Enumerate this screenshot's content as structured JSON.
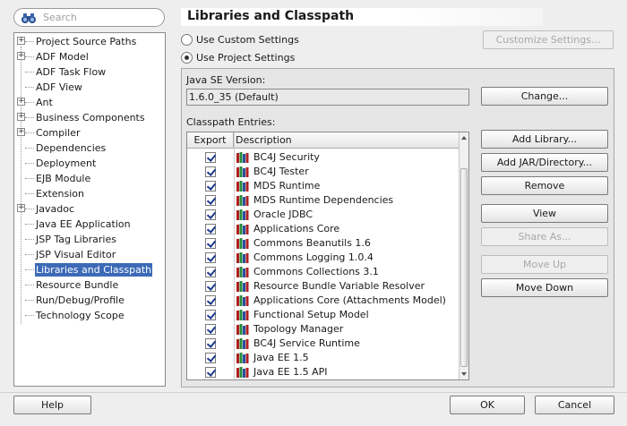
{
  "search": {
    "placeholder": "Search"
  },
  "nav": {
    "items": [
      {
        "label": "Project Source Paths",
        "expandable": true
      },
      {
        "label": "ADF Model",
        "expandable": true
      },
      {
        "label": "ADF Task Flow",
        "expandable": false
      },
      {
        "label": "ADF View",
        "expandable": false
      },
      {
        "label": "Ant",
        "expandable": true
      },
      {
        "label": "Business Components",
        "expandable": true
      },
      {
        "label": "Compiler",
        "expandable": true
      },
      {
        "label": "Dependencies",
        "expandable": false
      },
      {
        "label": "Deployment",
        "expandable": false
      },
      {
        "label": "EJB Module",
        "expandable": false
      },
      {
        "label": "Extension",
        "expandable": false
      },
      {
        "label": "Javadoc",
        "expandable": true
      },
      {
        "label": "Java EE Application",
        "expandable": false
      },
      {
        "label": "JSP Tag Libraries",
        "expandable": false
      },
      {
        "label": "JSP Visual Editor",
        "expandable": false
      },
      {
        "label": "Libraries and Classpath",
        "expandable": false,
        "selected": true
      },
      {
        "label": "Resource Bundle",
        "expandable": false
      },
      {
        "label": "Run/Debug/Profile",
        "expandable": false
      },
      {
        "label": "Technology Scope",
        "expandable": false
      }
    ]
  },
  "header": {
    "title": "Libraries and Classpath"
  },
  "settings": {
    "use_custom": "Use Custom Settings",
    "use_project": "Use Project Settings",
    "customize_button": "Customize Settings..."
  },
  "java_se": {
    "label": "Java SE Version:",
    "value": "1.6.0_35 (Default)",
    "change_button": "Change..."
  },
  "classpath": {
    "label": "Classpath Entries:",
    "columns": [
      "Export",
      "Description"
    ],
    "entries": [
      "BC4J Security",
      "BC4J Tester",
      "MDS Runtime",
      "MDS Runtime Dependencies",
      "Oracle JDBC",
      "Applications Core",
      "Commons Beanutils 1.6",
      "Commons Logging 1.0.4",
      "Commons Collections 3.1",
      "Resource Bundle Variable Resolver",
      "Applications Core (Attachments Model)",
      "Functional Setup Model",
      "Topology Manager",
      "BC4J Service Runtime",
      "Java EE 1.5",
      "Java EE 1.5 API"
    ]
  },
  "actions": {
    "add_library": "Add Library...",
    "add_jar": "Add JAR/Directory...",
    "remove": "Remove",
    "view": "View",
    "share_as": "Share As...",
    "move_up": "Move Up",
    "move_down": "Move Down"
  },
  "footer": {
    "help": "Help",
    "ok": "OK",
    "cancel": "Cancel"
  },
  "colors": {
    "selection": "#3d6ab7",
    "checkmark": "#1a3a8a"
  }
}
